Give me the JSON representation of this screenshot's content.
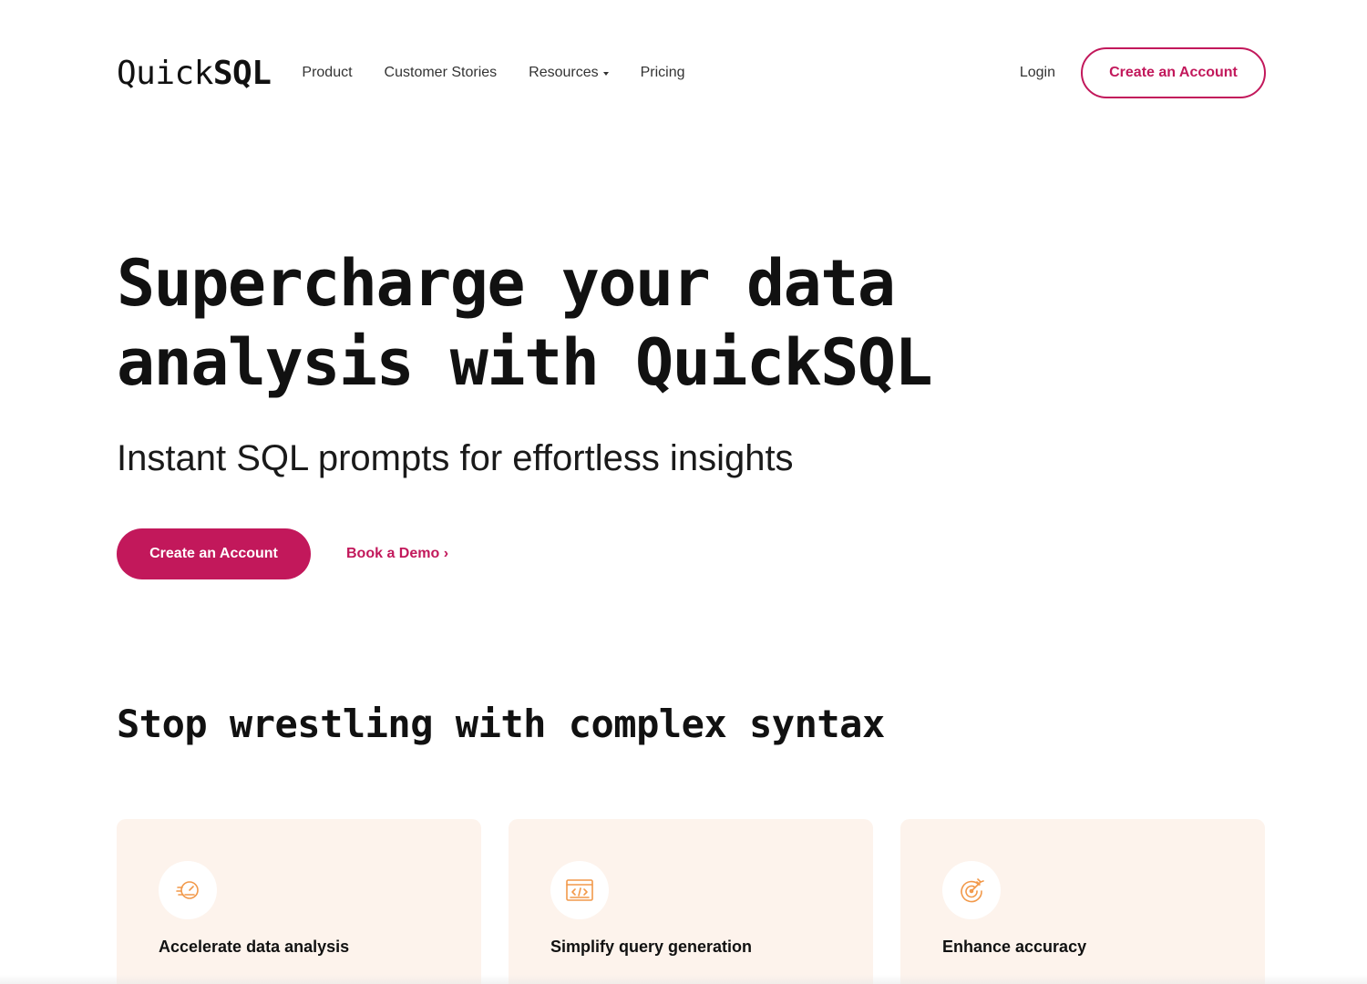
{
  "brand": {
    "logo_regular": "Quick",
    "logo_bold": "SQL",
    "accent_color": "#c2185b",
    "card_bg_color": "#fdf3ec",
    "icon_color": "#f2994a"
  },
  "nav": {
    "items": [
      {
        "label": "Product"
      },
      {
        "label": "Customer Stories"
      },
      {
        "label": "Resources",
        "has_dropdown": true
      },
      {
        "label": "Pricing"
      }
    ],
    "login_label": "Login",
    "cta_label": "Create an Account"
  },
  "hero": {
    "title_line1": "Supercharge your data",
    "title_line2": "analysis with QuickSQL",
    "subtitle": "Instant SQL prompts for effortless insights",
    "primary_cta": "Create an Account",
    "secondary_cta": "Book a Demo ›"
  },
  "features": {
    "heading": "Stop wrestling with complex syntax",
    "cards": [
      {
        "title": "Accelerate data analysis",
        "icon": "speedometer-icon"
      },
      {
        "title": "Simplify query generation",
        "icon": "code-window-icon"
      },
      {
        "title": "Enhance accuracy",
        "icon": "target-icon"
      }
    ]
  }
}
